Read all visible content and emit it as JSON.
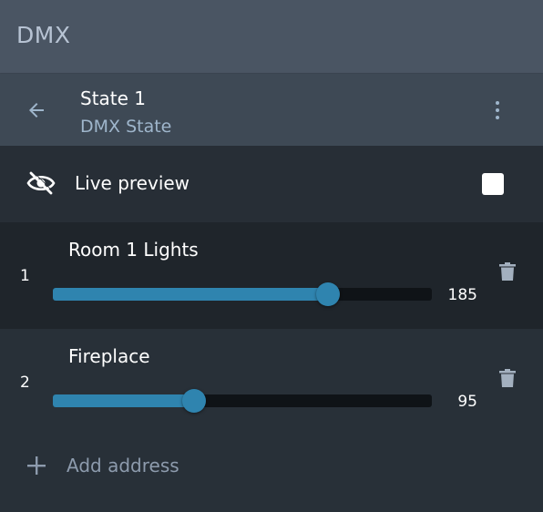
{
  "app": {
    "title": "DMX"
  },
  "state": {
    "name": "State 1",
    "type": "DMX State"
  },
  "preview": {
    "label": "Live preview",
    "checked": false
  },
  "channels": [
    {
      "number": "1",
      "name": "Room 1 Lights",
      "value": "185",
      "max": 255
    },
    {
      "number": "2",
      "name": "Fireplace",
      "value": "95",
      "max": 255
    }
  ],
  "actions": {
    "add_address": "Add address"
  },
  "icons": {
    "back": "arrow-left-icon",
    "more": "more-vertical-icon",
    "preview": "eye-off-icon",
    "delete": "trash-icon",
    "add": "plus-icon"
  },
  "colors": {
    "accent": "#2f84af",
    "header": "#4a5563",
    "subheader": "#3e4955",
    "background": "#283038",
    "subtitle": "#9fb6cc"
  }
}
